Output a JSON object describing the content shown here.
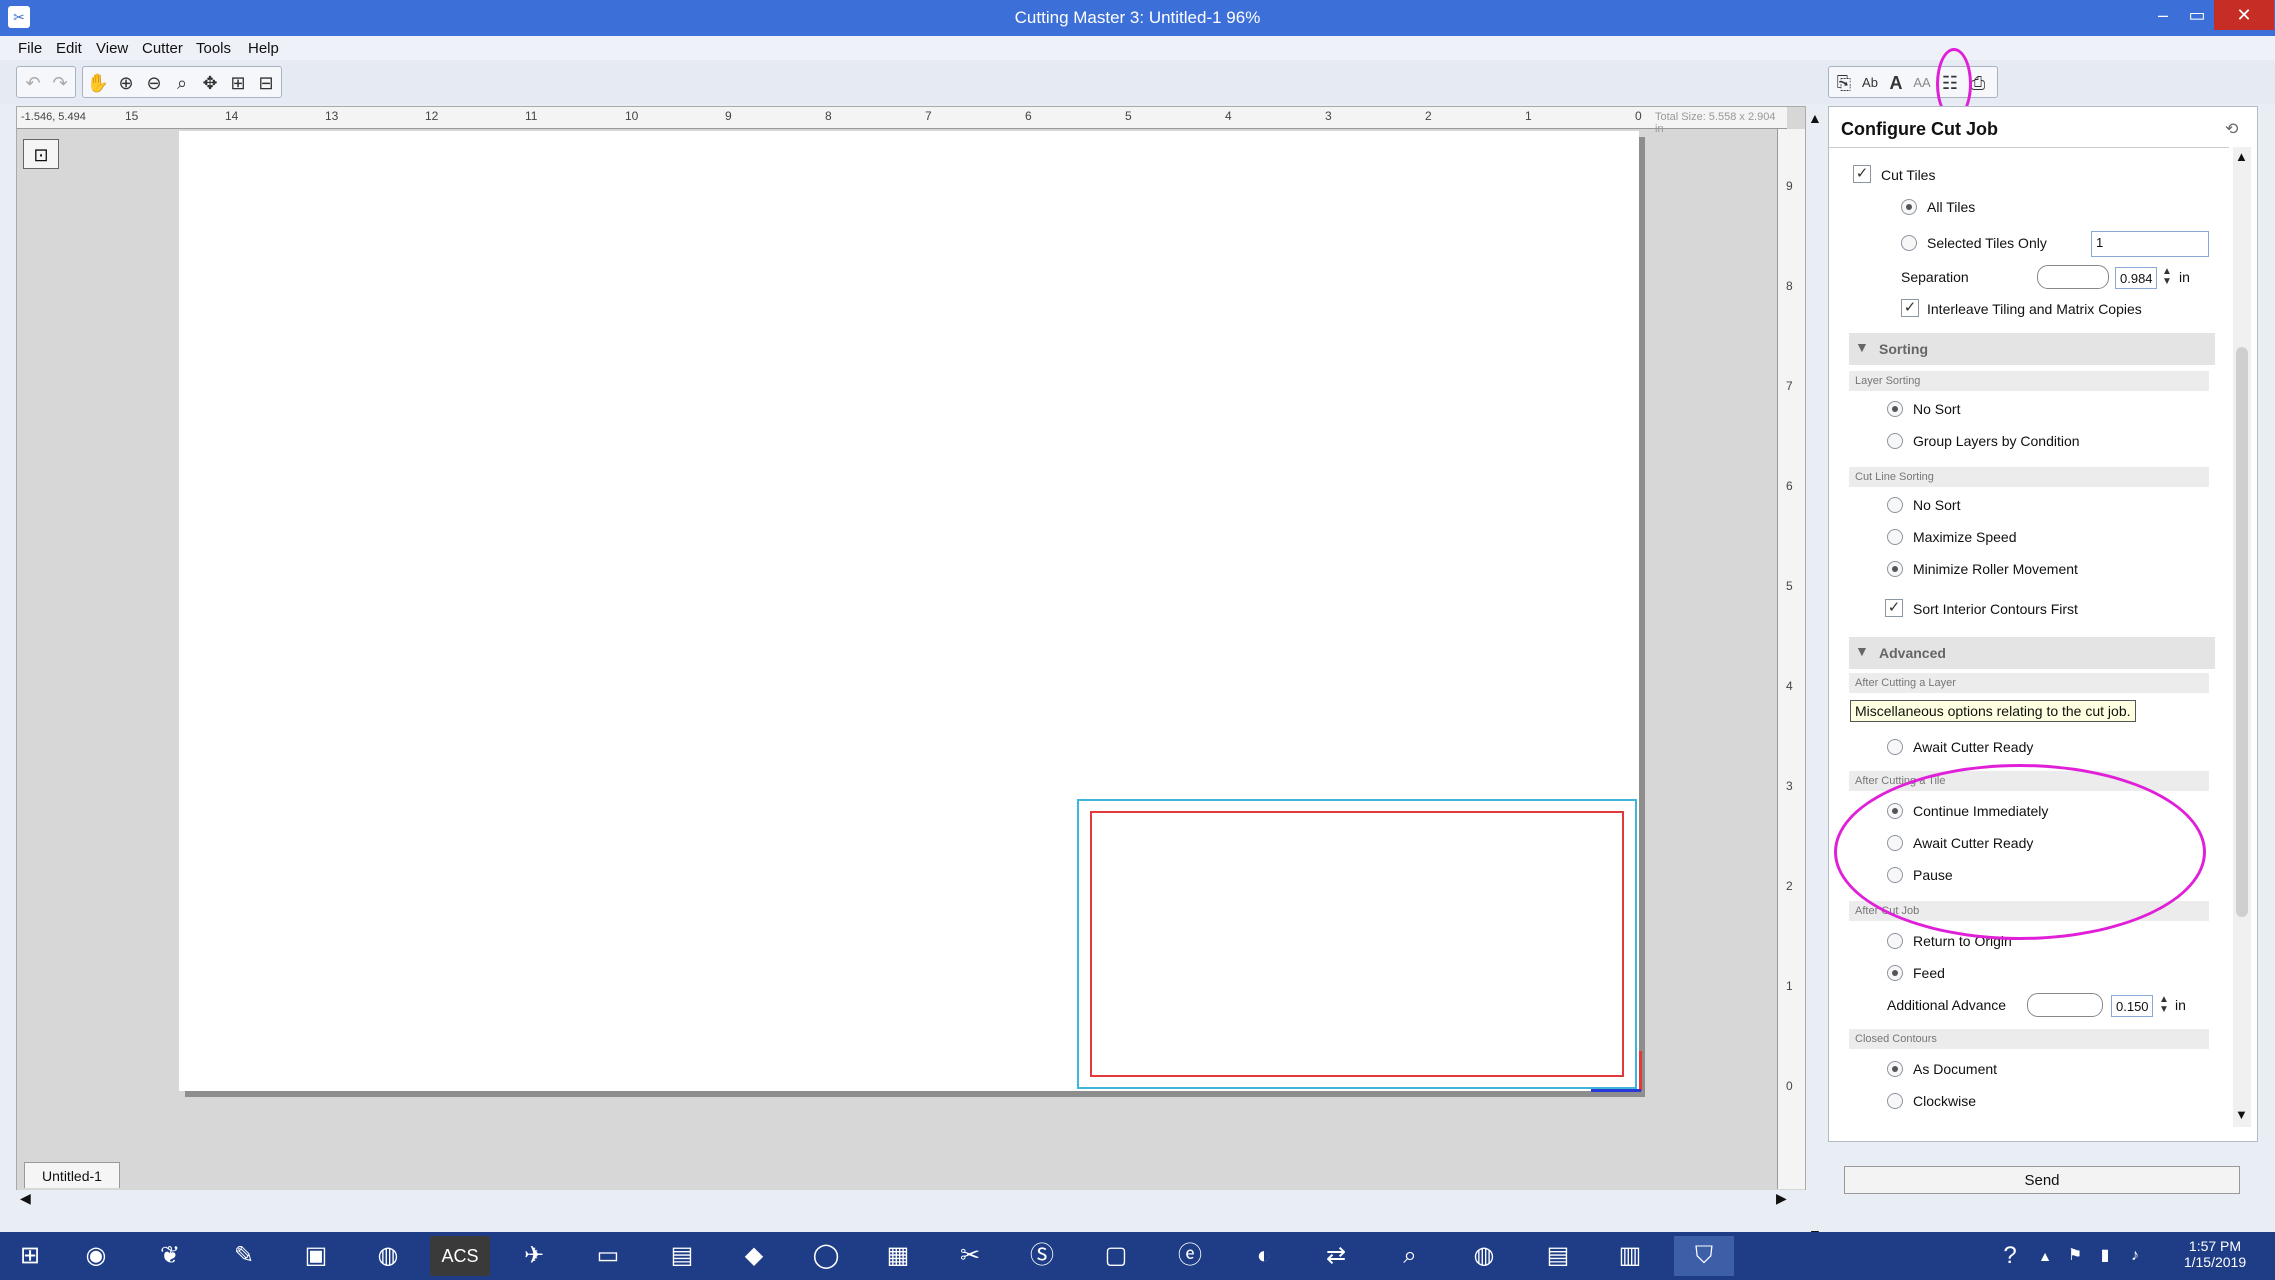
{
  "title": "Cutting Master 3: Untitled-1 96%",
  "menu": [
    "File",
    "Edit",
    "View",
    "Cutter",
    "Tools",
    "Help"
  ],
  "ruler": {
    "coords": "-1.546, 5.494",
    "total_size": "Total Size: 5.558 x 2.904 in",
    "h_ticks": [
      "15",
      "14",
      "13",
      "12",
      "11",
      "10",
      "9",
      "8",
      "7",
      "6",
      "5",
      "4",
      "3",
      "2",
      "1",
      "0"
    ],
    "v_ticks": [
      "9",
      "8",
      "7",
      "6",
      "5",
      "4",
      "3",
      "2",
      "1",
      "0"
    ]
  },
  "panel": {
    "title": "Configure Cut Job",
    "cut_tiles": "Cut Tiles",
    "all_tiles": "All Tiles",
    "selected_tiles": "Selected Tiles Only",
    "selected_value": "1",
    "separation": "Separation",
    "separation_value": "0.984",
    "unit": "in",
    "interleave": "Interleave Tiling and Matrix Copies",
    "sorting": "Sorting",
    "layer_sorting": "Layer Sorting",
    "no_sort": "No Sort",
    "group_layers": "Group Layers by Condition",
    "cut_line_sorting": "Cut Line Sorting",
    "no_sort_2": "No Sort",
    "max_speed": "Maximize Speed",
    "min_roller": "Minimize Roller Movement",
    "sort_interior": "Sort Interior Contours First",
    "advanced": "Advanced",
    "after_layer": "After Cutting a Layer",
    "tooltip": "Miscellaneous options relating to the cut job.",
    "await_ready_1": "Await Cutter Ready",
    "after_tile": "After Cutting a Tile",
    "continue_imm": "Continue Immediately",
    "await_ready_2": "Await Cutter Ready",
    "pause": "Pause",
    "after_job": "After Cut Job",
    "return_origin": "Return to Origin",
    "feed": "Feed",
    "additional_advance": "Additional Advance",
    "advance_value": "0.150",
    "closed_contours": "Closed Contours",
    "as_document": "As Document",
    "clockwise": "Clockwise",
    "send": "Send"
  },
  "doc_tab": "Untitled-1",
  "taskbar": {
    "acs_label": "ACS",
    "time": "1:57 PM",
    "date": "1/15/2019"
  },
  "colors": {
    "titlebar": "#3c6fd8",
    "highlight": "#e020d8",
    "tile_outline": "#41b5d9",
    "cut_outline": "#e23a3a"
  }
}
